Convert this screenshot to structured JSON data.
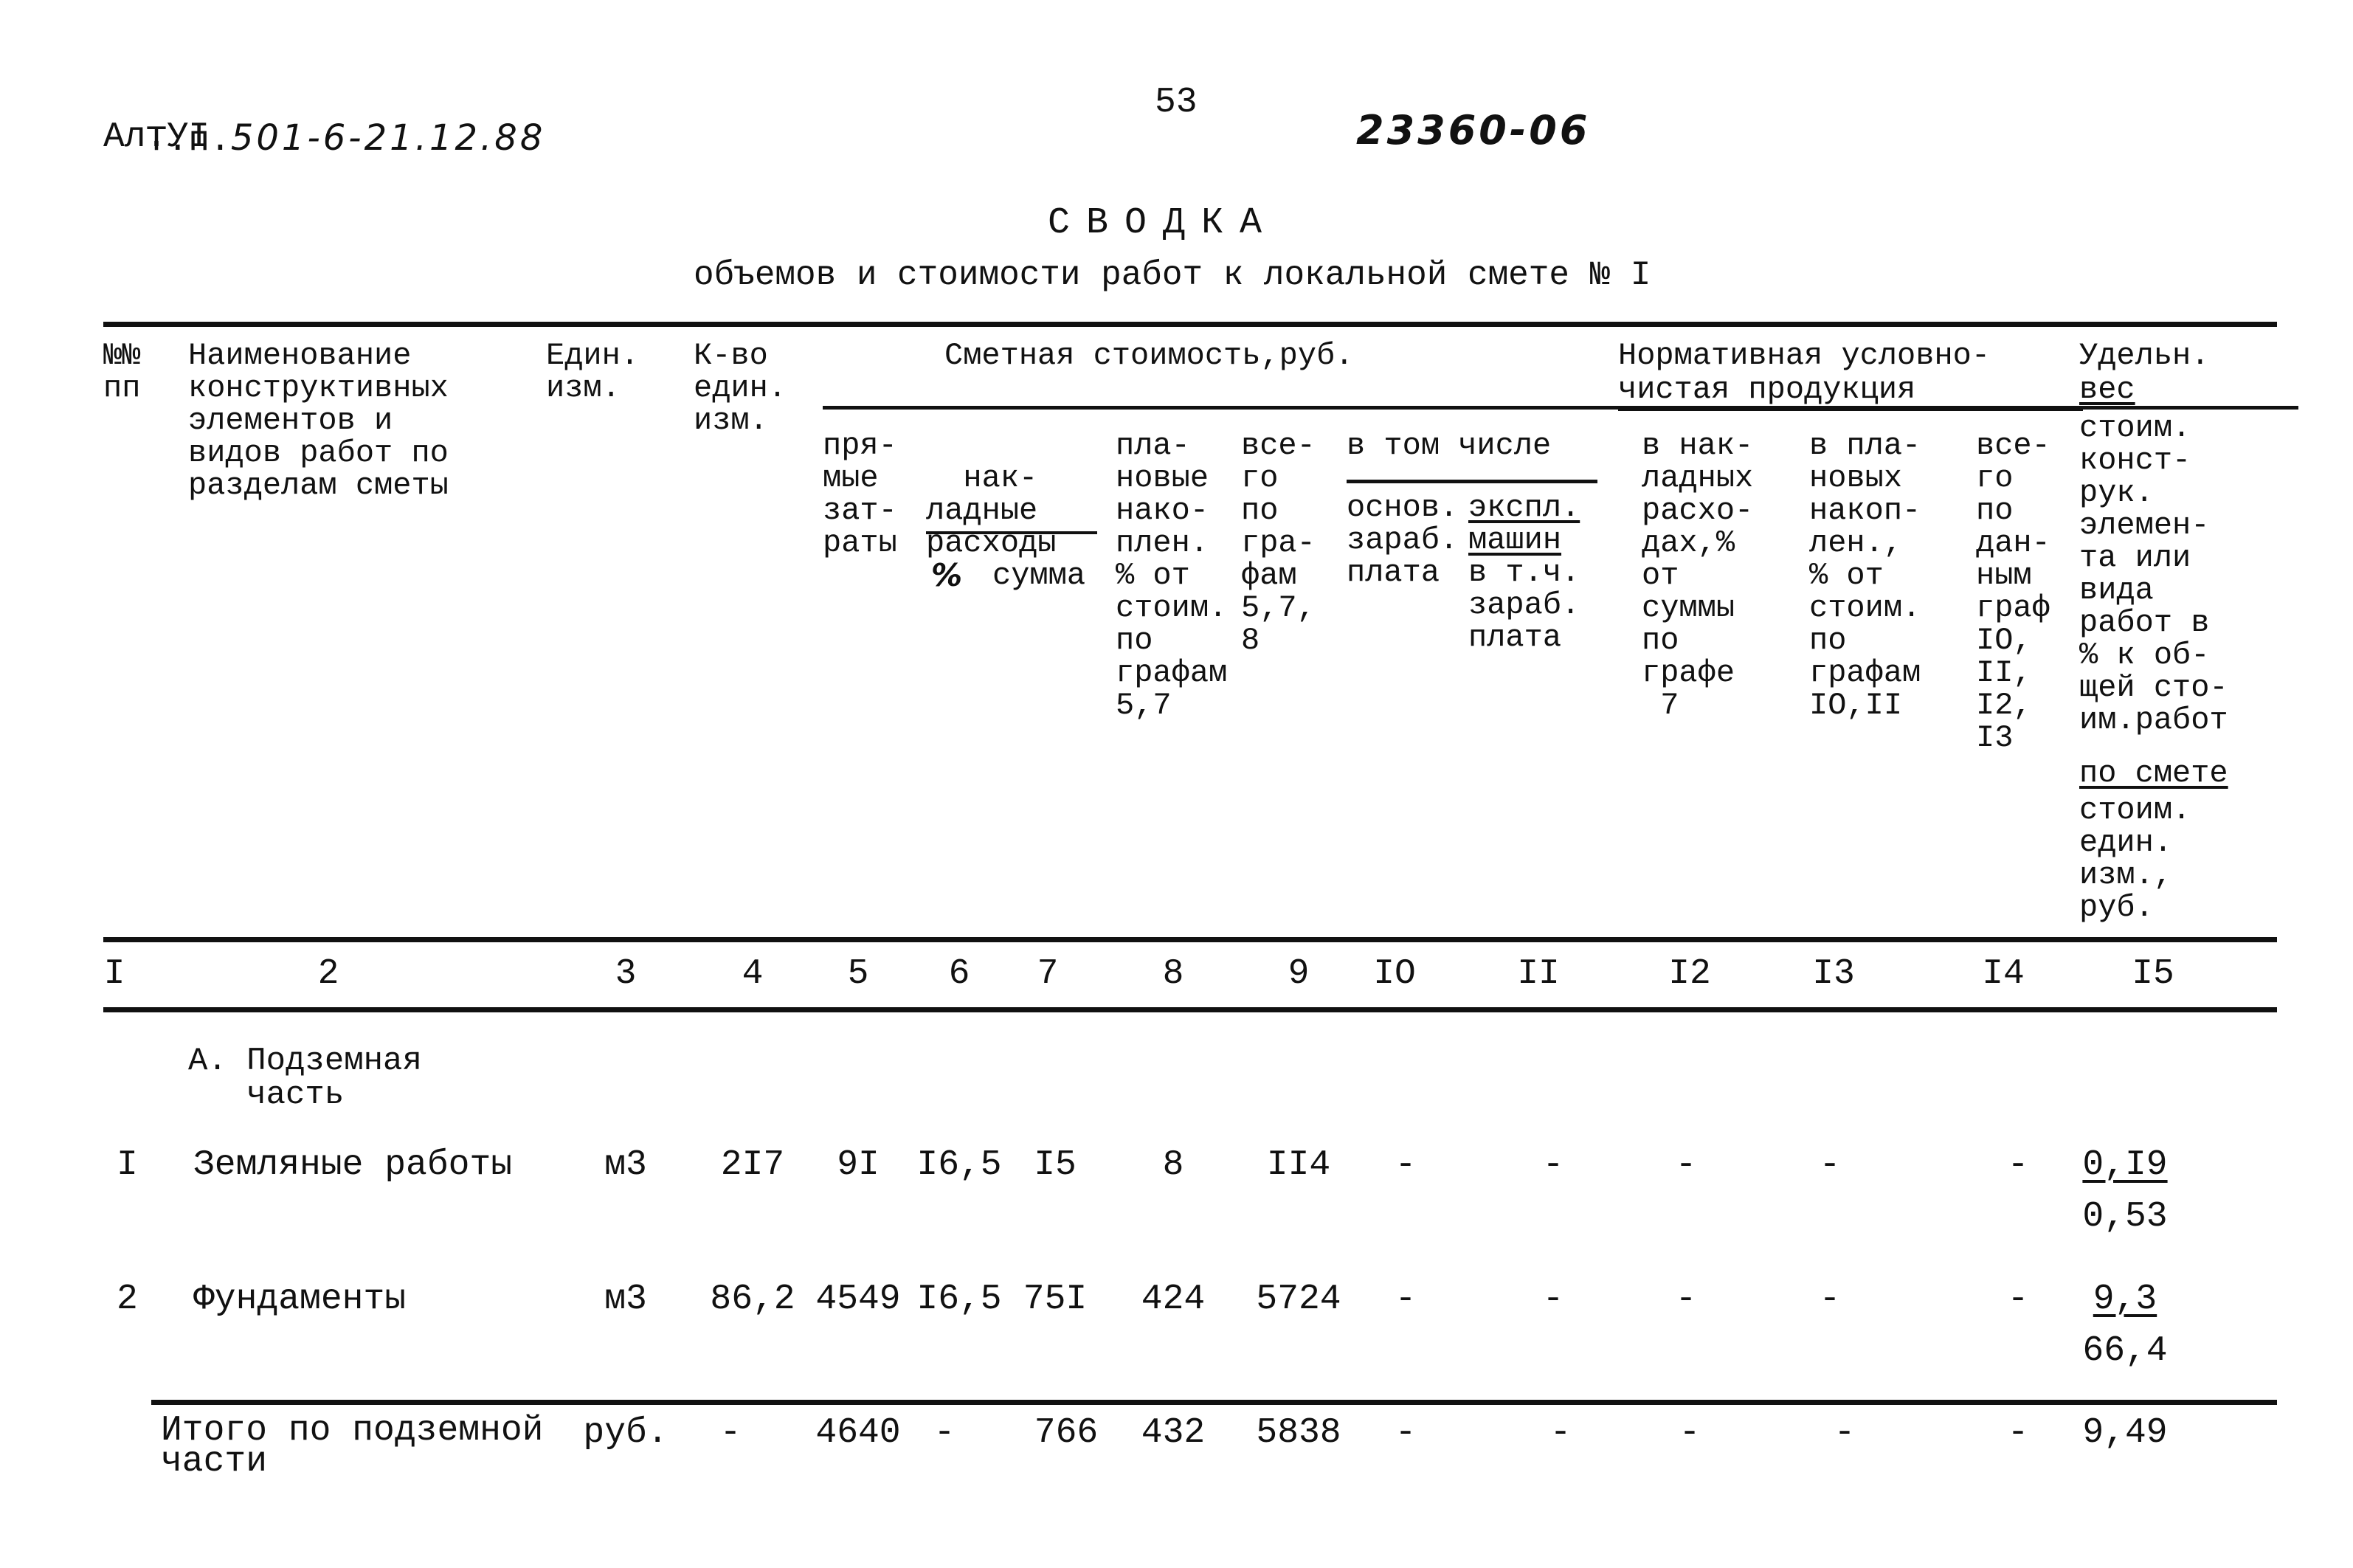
{
  "page_header": {
    "project_prefix": "Т.п.",
    "project_code": "501-6-21.12.88",
    "album": "Ал.УI",
    "page_number": "53",
    "doc_number": "23360-06"
  },
  "title": {
    "main": "СВОДКА",
    "subtitle": "объемов и стоимости работ к локальной смете № I"
  },
  "table": {
    "headers": {
      "num": "№№\nпп",
      "name": "Наименование\nконструктивных\nэлементов и\nвидов работ по\nразделам сметы",
      "unit": "Един.\nизм.",
      "qty": "К-во\nедин.\nизм.",
      "cost_group": "Сметная стоимость,руб.",
      "direct": "пря-\nмые\nзат-\nраты",
      "overhead_group": "нак-\nладные\nрасходы",
      "overhead_pct": "%",
      "overhead_sum": "сумма",
      "planned": "пла-\nновые\nнако-\nплен.\n% от\nстоим.\nпо\nграфам\n5,7",
      "total": "все-\nго\nпо\nгра-\nфам\n5,7,\n8",
      "incl_group": "в том числе",
      "base_wage": "основ.\nзараб.\nплата",
      "machines": "экспл.\nмашин",
      "machines_wage": "в т.ч.\nзараб.\nплата",
      "npp_group_line1": "Нормативная условно-",
      "npp_group_line2": "чистая продукция",
      "npp_overhead": "в нак-\nладных\nрасхо-\nдах,%\nот\nсуммы\nпо\nграфе\n 7",
      "npp_planned": "в пла-\nновых\nнакоп-\nлен.,\n% от\nстоим.\nпо\nграфам\nIO,II",
      "npp_total": "все-\nго\nпо\nдан-\nным\nграф\nIO,\nII,\nI2,\nI3",
      "share_line1": "Удельн.",
      "share_line2": "вес",
      "share_rest": "стоим.\nконст-\nрук.\nэлемен-\nта или\nвида\nработ в\n% к об-\nщей сто-\nим.работ",
      "share_underlined": "по смете",
      "share_tail": "стоим.\nедин.\nизм.,\nруб."
    },
    "column_numbers": [
      "I",
      "2",
      "3",
      "4",
      "5",
      "6",
      "7",
      "8",
      "9",
      "IO",
      "II",
      "I2",
      "I3",
      "I4",
      "I5"
    ],
    "section_title": "А. Подземная\n   часть",
    "rows": [
      {
        "num": "I",
        "name": "Земляные работы",
        "unit": "м3",
        "qty": "2I7",
        "direct": "9I",
        "overhead_pct": "I6,5",
        "overhead_sum": "I5",
        "planned": "8",
        "total": "II4",
        "base_wage": "-",
        "machines": "-",
        "npp_overhead": "-",
        "npp_planned": "-",
        "npp_total": "-",
        "share_top": "0,I9",
        "share_bottom": "0,53"
      },
      {
        "num": "2",
        "name": "Фундаменты",
        "unit": "м3",
        "qty": "86,2",
        "direct": "4549",
        "overhead_pct": "I6,5",
        "overhead_sum": "75I",
        "planned": "424",
        "total": "5724",
        "base_wage": "-",
        "machines": "-",
        "npp_overhead": "-",
        "npp_planned": "-",
        "npp_total": "-",
        "share_top": "9,3",
        "share_bottom": "66,4"
      }
    ],
    "total_row": {
      "label": "Итого по подземной\nчасти",
      "unit": "руб.",
      "qty": "-",
      "direct": "4640",
      "overhead_pct": "-",
      "overhead_sum": "766",
      "planned": "432",
      "total": "5838",
      "base_wage": "-",
      "machines": "-",
      "npp_overhead": "-",
      "npp_planned": "-",
      "npp_total": "-",
      "share": "9,49"
    }
  }
}
